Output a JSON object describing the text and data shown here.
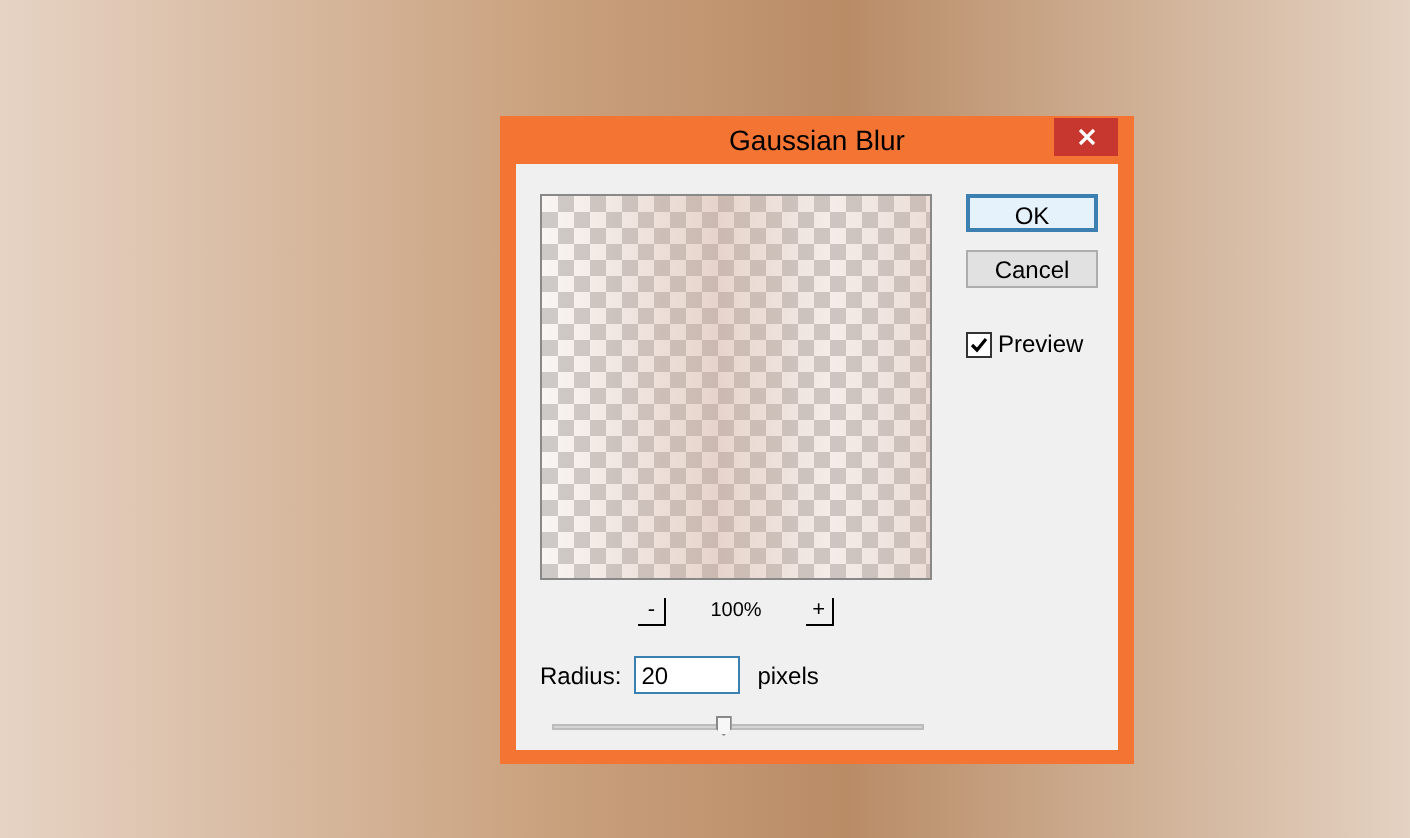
{
  "dialog": {
    "title": "Gaussian Blur",
    "zoom": {
      "out_label": "-",
      "percent": "100%",
      "in_label": "+"
    },
    "radius": {
      "label": "Radius:",
      "value": "20",
      "unit": "pixels",
      "level": 0.46
    },
    "buttons": [
      {
        "label": "OK",
        "default": true
      },
      {
        "label": "Cancel",
        "default": false
      }
    ],
    "preview": {
      "label": "Preview",
      "checked": true
    }
  }
}
